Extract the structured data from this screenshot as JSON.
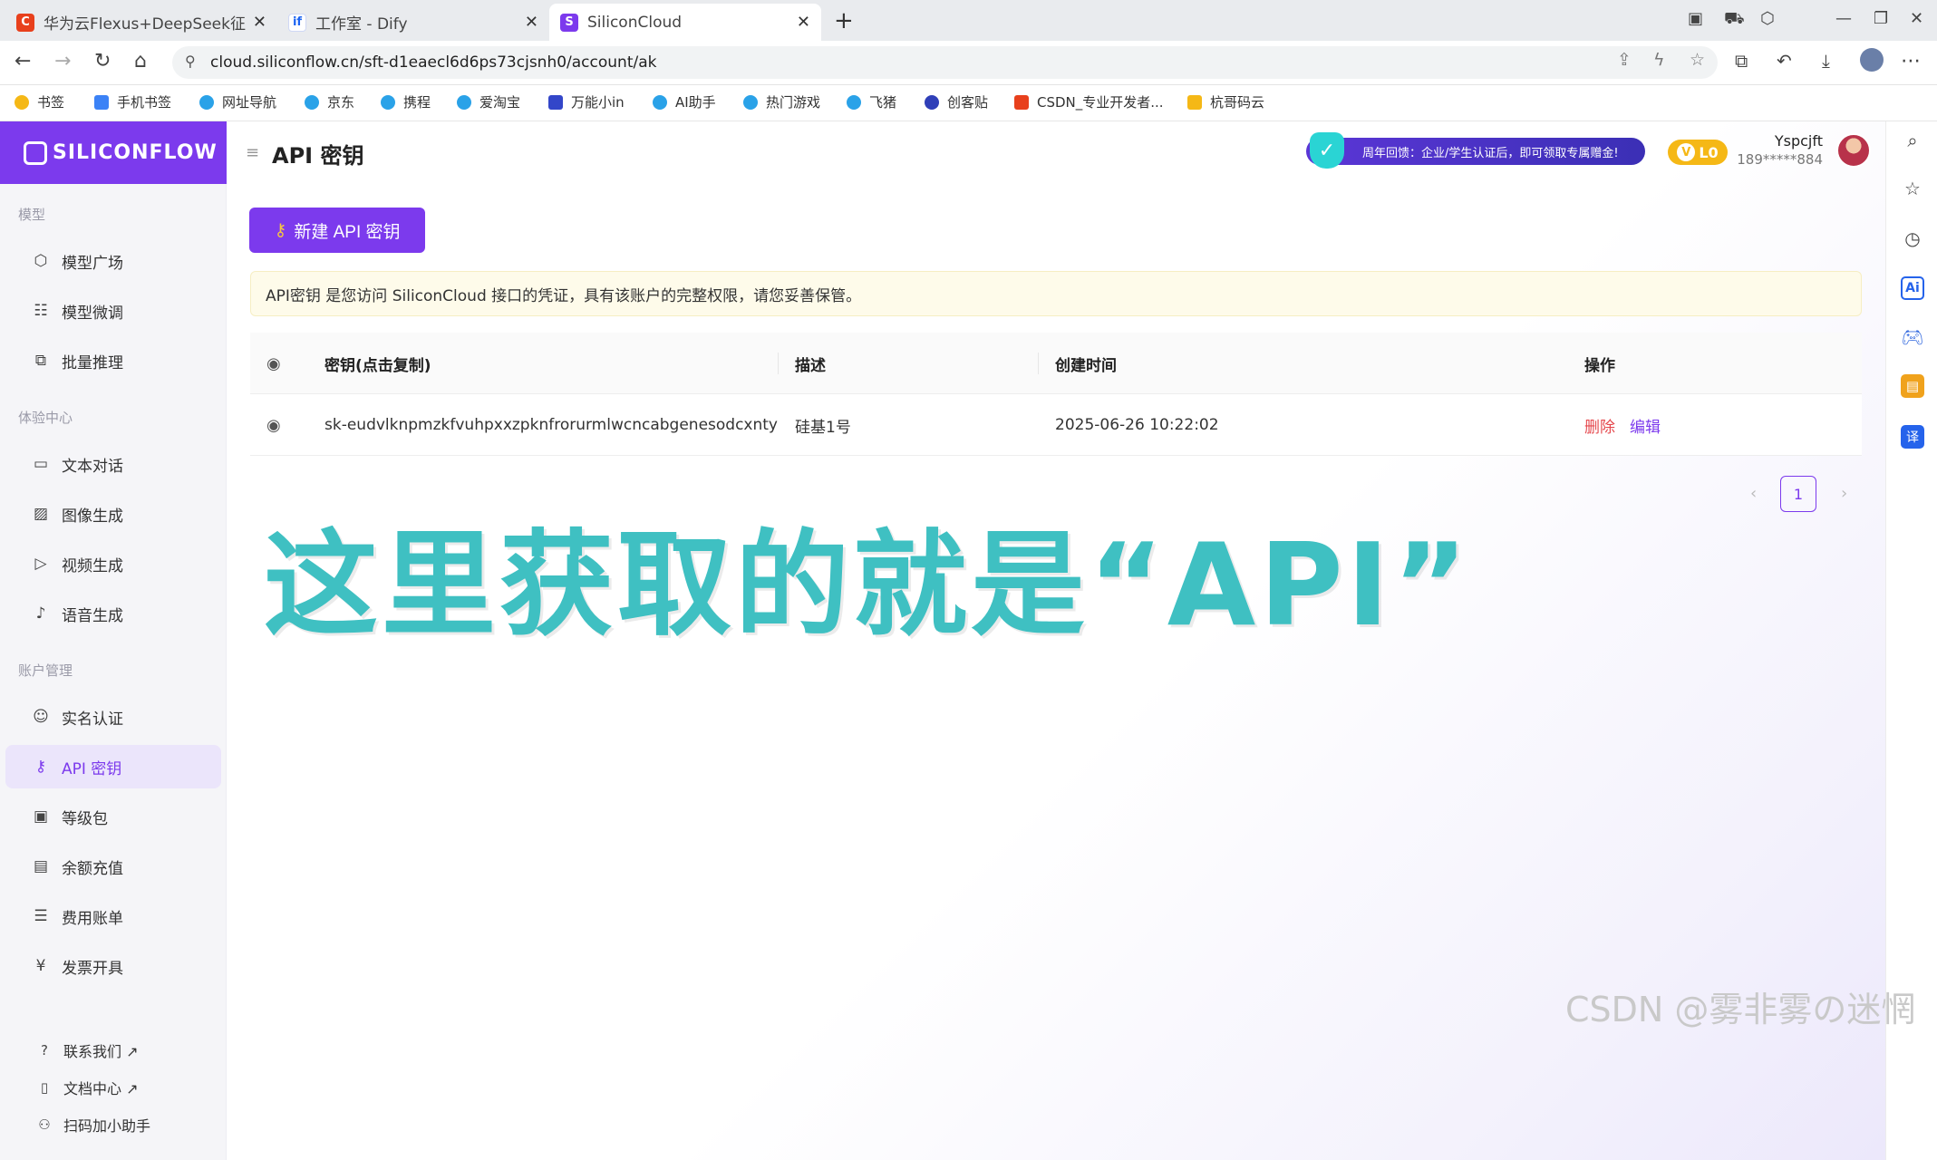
{
  "tabs": [
    {
      "title": "华为云Flexus+DeepSeek征文 | 基",
      "favicon_text": "C",
      "favicon_color": "#e8401c"
    },
    {
      "title": "工作室 - Dify",
      "favicon_text": "if",
      "favicon_color": "#1c64f2"
    },
    {
      "title": "SiliconCloud",
      "favicon_text": "S",
      "favicon_color": "#7c3aed"
    }
  ],
  "address": {
    "url": "cloud.siliconflow.cn/sft-d1eaecl6d6ps73cjsnh0/account/ak"
  },
  "bookmarks": [
    "书签",
    "手机书签",
    "网址导航",
    "京东",
    "携程",
    "爱淘宝",
    "万能小in",
    "AI助手",
    "热门游戏",
    "飞猪",
    "创客贴",
    "CSDN_专业开发者...",
    "杭哥码云"
  ],
  "sidebar": {
    "logo": "SILICONFLOW",
    "sections": [
      {
        "title": "模型",
        "items": [
          {
            "label": "模型广场",
            "icon": "cube-icon"
          },
          {
            "label": "模型微调",
            "icon": "sliders-icon"
          },
          {
            "label": "批量推理",
            "icon": "copy-icon"
          }
        ]
      },
      {
        "title": "体验中心",
        "items": [
          {
            "label": "文本对话",
            "icon": "chat-icon"
          },
          {
            "label": "图像生成",
            "icon": "image-icon"
          },
          {
            "label": "视频生成",
            "icon": "video-icon"
          },
          {
            "label": "语音生成",
            "icon": "mic-icon"
          }
        ]
      },
      {
        "title": "账户管理",
        "items": [
          {
            "label": "实名认证",
            "icon": "user-check-icon"
          },
          {
            "label": "API 密钥",
            "icon": "key-icon"
          },
          {
            "label": "等级包",
            "icon": "wallet-icon"
          },
          {
            "label": "余额充值",
            "icon": "card-icon"
          },
          {
            "label": "费用账单",
            "icon": "bill-icon"
          },
          {
            "label": "发票开具",
            "icon": "invoice-icon"
          }
        ]
      }
    ],
    "footer": [
      {
        "label": "联系我们 ↗",
        "icon": "help-icon"
      },
      {
        "label": "文档中心 ↗",
        "icon": "doc-icon"
      },
      {
        "label": "扫码加小助手",
        "icon": "people-icon"
      }
    ]
  },
  "header": {
    "title": "API 密钥",
    "promo": "周年回馈：企业/学生认证后，即可领取专属赠金!",
    "level": "L0",
    "user_name": "Yspcjft",
    "user_phone": "189*****884"
  },
  "main": {
    "new_key_button": "新建 API 密钥",
    "notice": "API密钥 是您访问 SiliconCloud 接口的凭证，具有该账户的完整权限，请您妥善保管。",
    "table": {
      "headers": [
        "密钥(点击复制)",
        "描述",
        "创建时间",
        "操作"
      ],
      "rows": [
        {
          "key": "sk-eudvlknpmzkfvuhpxxzpknfrorurmlwcncabgenesodcxnty",
          "desc": "硅基1号",
          "created": "2025-06-26 10:22:02",
          "delete": "删除",
          "edit": "编辑"
        }
      ]
    },
    "pagination": {
      "current": "1"
    }
  },
  "overlay_text": "这里获取的就是“API”",
  "watermark": "CSDN @雾非雾の迷惘",
  "colors": {
    "brand": "#7c3aed",
    "overlay": "#3fc0c2",
    "danger": "#e5484d",
    "notice_bg": "#fefbea"
  }
}
